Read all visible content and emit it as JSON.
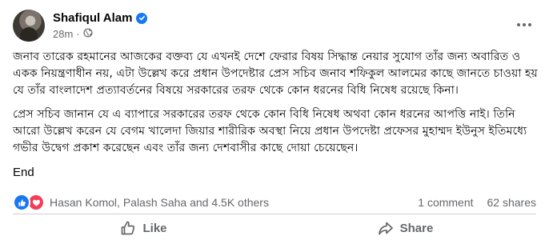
{
  "post": {
    "author": "Shafiqul Alam",
    "time": "28m",
    "separator": "·",
    "paragraphs": [
      "জনাব তারেক রহমানের আজকের বক্তব্য যে এখনই দেশে ফেরার বিষয় সিদ্ধান্ত নেয়ার সুযোগ তাঁর জন্য অবারিত ও একক নিয়ন্ত্রণাধীন নয়, এটা উল্লেখ করে প্রধান উপদেষ্টার প্রেস সচিব জনাব শফিকুল আলমের কাছে জানতে চাওয়া হয় যে তাঁর বাংলাদেশ প্রত্যাবর্তনের বিষয়ে সরকারের তরফ থেকে কোন ধরনের বিধি নিষেধ রয়েছে কিনা।",
      "প্রেস সচিব জানান যে এ ব্যাপারে সরকারের তরফ থেকে কোন বিধি নিষেধ অথবা কোন ধরনের আপত্তি নাই। তিনি আরো উল্লেখ করেন যে বেগম খালেদা জিয়ার শারীরিক অবস্থা নিয়ে প্রধান উপদেষ্টা প্রফেসর মুহাম্মদ ইউনুস ইতিমধ্যে গভীর উদ্বেগ প্রকাশ করেছেন এবং তাঁর জন্য দেশবাসীর কাছে দোয়া চেয়েছেন।"
    ],
    "closing": "End"
  },
  "stats": {
    "reactors": "Hasan Komol, Palash Saha and 4.5K others",
    "comments": "1 comment",
    "shares": "62 shares"
  },
  "actions": {
    "like": "Like",
    "share": "Share"
  },
  "colors": {
    "facebook_blue": "#1877f2",
    "love_red": "#f33e58",
    "secondary_text": "#65676b"
  }
}
